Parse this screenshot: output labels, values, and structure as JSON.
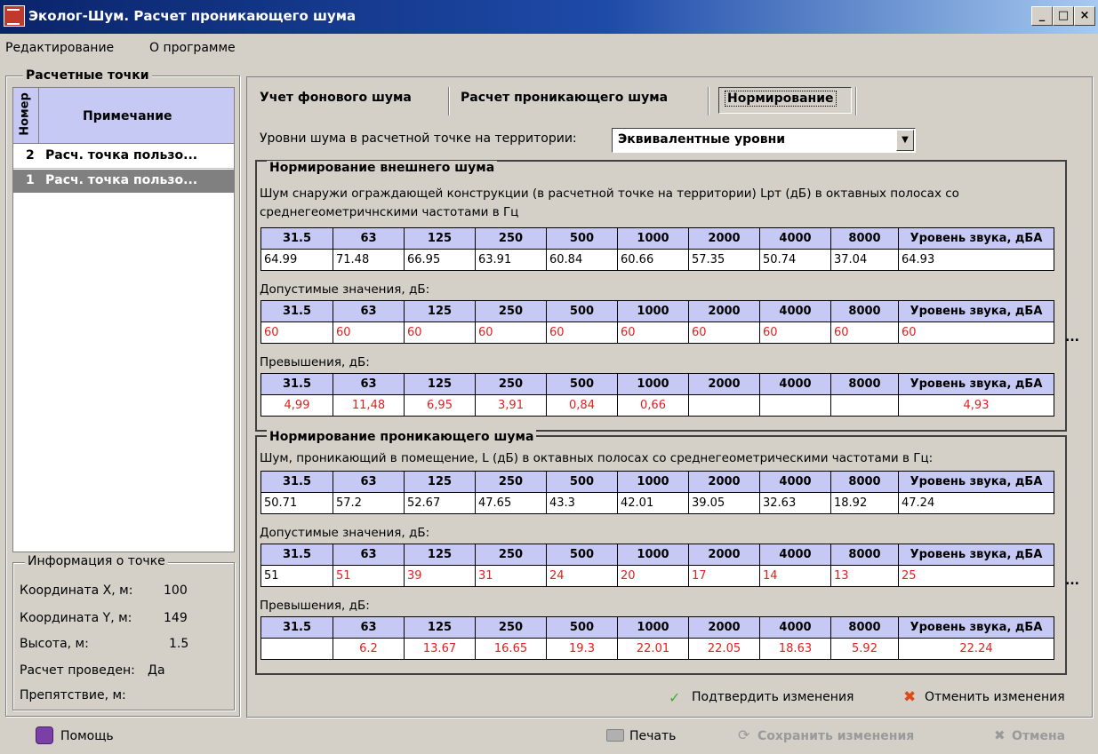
{
  "window": {
    "title": "Эколог-Шум. Расчет проникающего шума",
    "controls": [
      "_",
      "□",
      "×"
    ]
  },
  "menu": [
    "Редактирование",
    "О программе"
  ],
  "left_panel": {
    "title": "Расчетные точки",
    "columns": [
      "Номер",
      "Примечание"
    ],
    "rows": [
      {
        "num": "2",
        "note": "Расч. точка пользо..."
      },
      {
        "num": "1",
        "note": "Расч. точка пользо..."
      }
    ],
    "info": {
      "title": "Информация о точке",
      "x_label": "Координата X, м:",
      "x_value": "100",
      "y_label": "Координата Y, м:",
      "y_value": "149",
      "h_label": "Высота, м:",
      "h_value": "1.5",
      "calc_label": "Расчет проведен:",
      "calc_value": "Да",
      "obstacle_label": "Препятствие, м:"
    }
  },
  "tabs": [
    "Учет фонового шума",
    "Расчет проникающего шума",
    "Нормирование"
  ],
  "levels": {
    "label": "Уровни шума в расчетной точке на территории:",
    "selected": "Эквивалентные уровни"
  },
  "headers": [
    "31.5",
    "63",
    "125",
    "250",
    "500",
    "1000",
    "2000",
    "4000",
    "8000",
    "Уровень звука, дБА"
  ],
  "external": {
    "title": "Нормирование внешнего шума",
    "description_line1": "Шум снаружи ограждающей конструкции (в расчетной точке на территории) Lpт (дБ) в октавных полосах со",
    "description_line2": "среднегеометричнскими частотами в Гц",
    "values": [
      "64.99",
      "71.48",
      "66.95",
      "63.91",
      "60.84",
      "60.66",
      "57.35",
      "50.74",
      "37.04",
      "64.93"
    ],
    "allowed_label": "Допустимые значения, дБ:",
    "allowed": [
      "60",
      "60",
      "60",
      "60",
      "60",
      "60",
      "60",
      "60",
      "60",
      "60"
    ],
    "excess_label": "Превышения, дБ:",
    "excess": [
      "4,99",
      "11,48",
      "6,95",
      "3,91",
      "0,84",
      "0,66",
      "",
      "",
      "",
      "4,93"
    ]
  },
  "penetrating": {
    "title": "Нормирование проникающего шума",
    "description": "Шум, проникающий в помещение, L (дБ) в октавных полосах со среднегеометрическими частотами в Гц:",
    "values": [
      "50.71",
      "57.2",
      "52.67",
      "47.65",
      "43.3",
      "42.01",
      "39.05",
      "32.63",
      "18.92",
      "47.24"
    ],
    "allowed_label": "Допустимые значения, дБ:",
    "allowed": [
      "51",
      "51",
      "39",
      "31",
      "24",
      "20",
      "17",
      "14",
      "13",
      "25"
    ],
    "excess_label": "Превышения, дБ:",
    "excess": [
      "",
      "6.2",
      "13.67",
      "16.65",
      "19.3",
      "22.01",
      "22.05",
      "18.63",
      "5.92",
      "22.24"
    ]
  },
  "ellipsis": "...",
  "actions": {
    "confirm": "Подтвердить изменения",
    "cancel_changes": "Отменить изменения"
  },
  "bottom": {
    "help": "Помощь",
    "print": "Печать",
    "save": "Сохранить изменения",
    "cancel": "Отмена"
  },
  "colors": {
    "header_bg": "#c6c9f3",
    "red_text": "#e02020",
    "title_bar": "#0a246a",
    "selected_row": "#808080"
  }
}
